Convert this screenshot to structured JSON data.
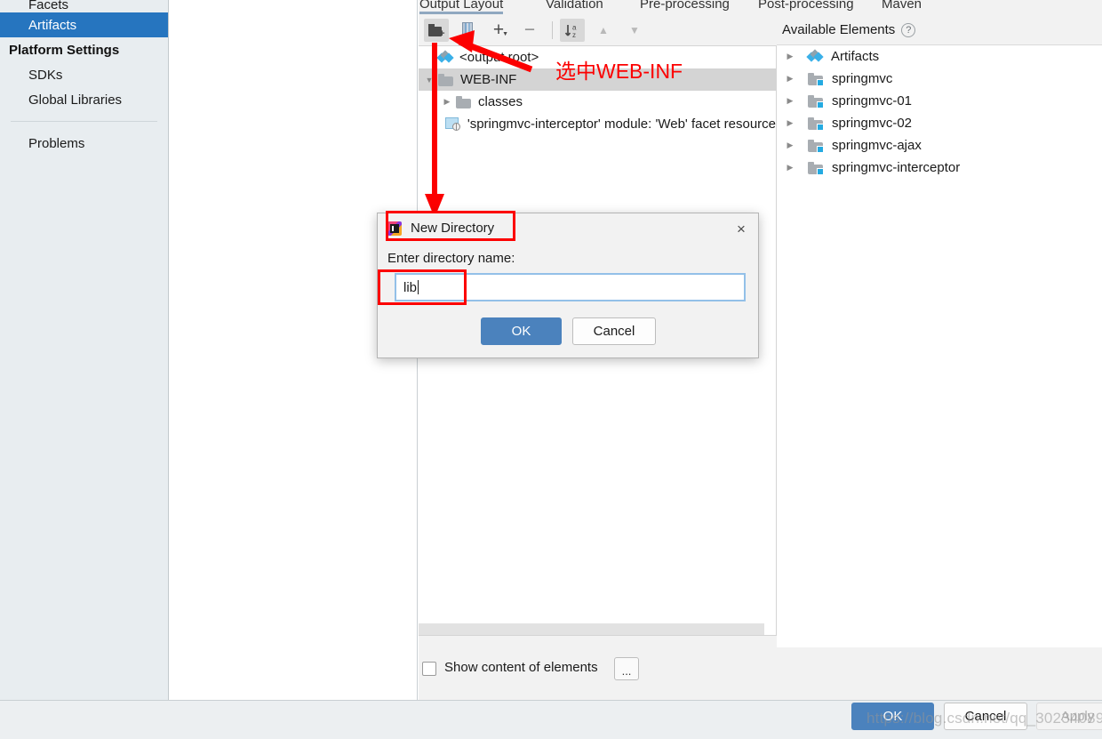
{
  "sidebar": {
    "items": [
      {
        "label": "Facets",
        "type": "item",
        "selected": false,
        "clipped": true
      },
      {
        "label": "Artifacts",
        "type": "item",
        "selected": true
      },
      {
        "label": "Platform Settings",
        "type": "header"
      },
      {
        "label": "SDKs",
        "type": "item",
        "selected": false
      },
      {
        "label": "Global Libraries",
        "type": "item",
        "selected": false
      },
      {
        "label": "Problems",
        "type": "item",
        "selected": false
      }
    ],
    "help_icon": "?"
  },
  "tabs": [
    {
      "label": "Output Layout",
      "active": true
    },
    {
      "label": "Validation",
      "active": false
    },
    {
      "label": "Pre-processing",
      "active": false
    },
    {
      "label": "Post-processing",
      "active": false
    },
    {
      "label": "Maven",
      "active": false
    }
  ],
  "toolbar": {
    "buttons": [
      {
        "name": "new-directory-icon",
        "label": "Create Directory",
        "pressed": true
      },
      {
        "name": "create-archive-icon",
        "label": "Create Archive",
        "pressed": false
      },
      {
        "name": "add-icon",
        "label": "Add",
        "glyph": "+",
        "pressed": false
      },
      {
        "name": "remove-icon",
        "label": "Remove",
        "glyph": "−",
        "pressed": false
      },
      {
        "name": "sort-icon",
        "label": "Sort by Name",
        "pressed": true
      },
      {
        "name": "move-up-icon",
        "label": "Move Up",
        "glyph": "▲",
        "pressed": false
      },
      {
        "name": "move-down-icon",
        "label": "Move Down",
        "glyph": "▼",
        "pressed": false
      }
    ]
  },
  "output_tree": {
    "rows": [
      {
        "label": "<output root>",
        "icon": "artifact-diamond-icon",
        "indent": 0,
        "twisty": "",
        "selected": false
      },
      {
        "label": "WEB-INF",
        "icon": "folder-icon",
        "indent": 0,
        "twisty": "▼",
        "selected": true
      },
      {
        "label": "classes",
        "icon": "folder-icon",
        "indent": 1,
        "twisty": "▶",
        "selected": false
      },
      {
        "label": "'springmvc-interceptor' module: 'Web' facet resource",
        "icon": "facet-resource-icon",
        "indent": 1,
        "twisty": "",
        "selected": false
      }
    ]
  },
  "bottom_options": {
    "checkbox_label": "Show content of elements",
    "checkbox_checked": false,
    "ellipsis_button": "..."
  },
  "available_elements": {
    "title": "Available Elements",
    "help_glyph": "?",
    "rows": [
      {
        "label": "Artifacts",
        "icon": "artifact-diamond-icon",
        "twisty": "▶"
      },
      {
        "label": "springmvc",
        "icon": "module-icon",
        "twisty": "▶"
      },
      {
        "label": "springmvc-01",
        "icon": "module-icon",
        "twisty": "▶"
      },
      {
        "label": "springmvc-02",
        "icon": "module-icon",
        "twisty": "▶"
      },
      {
        "label": "springmvc-ajax",
        "icon": "module-icon",
        "twisty": "▶"
      },
      {
        "label": "springmvc-interceptor",
        "icon": "module-icon",
        "twisty": "▶"
      }
    ]
  },
  "dialog": {
    "title": "New Directory",
    "app_icon": "intellij-idea-icon",
    "close_glyph": "×",
    "field_label": "Enter directory name:",
    "field_value": "lib",
    "field_placeholder": "",
    "ok_label": "OK",
    "cancel_label": "Cancel"
  },
  "footer": {
    "ok_label": "OK",
    "cancel_label": "Cancel",
    "apply_label": "Apply",
    "apply_enabled": false
  },
  "annotations": {
    "text_select_webinf": "选中WEB-INF",
    "color": "#fc0000"
  },
  "watermark": {
    "text": "https://blog.csdn.net/qq_30234089"
  }
}
